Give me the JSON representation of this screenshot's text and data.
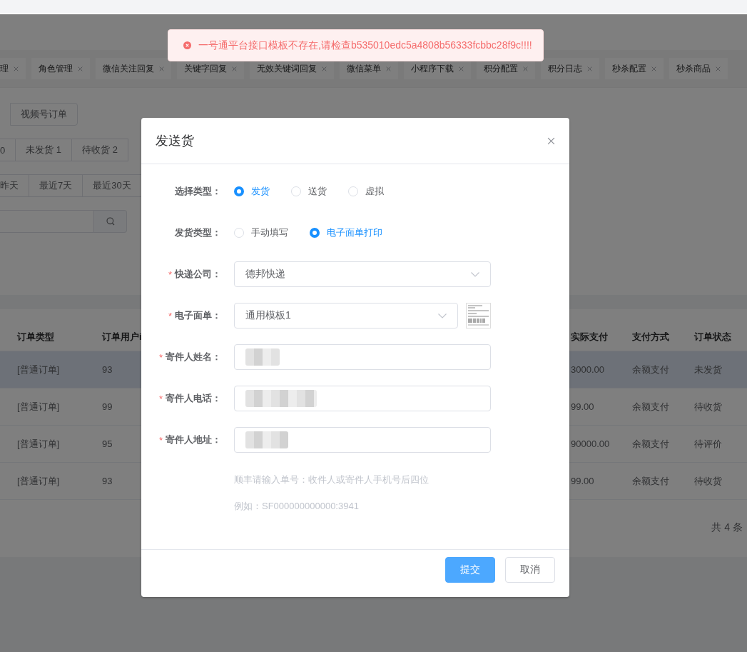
{
  "toast": {
    "kind": "error",
    "text": "一号通平台接口模板不存在,请检查b535010edc5a4808b56333fcbbc28f9c!!!!"
  },
  "tabs": [
    {
      "label": "理"
    },
    {
      "label": "角色管理"
    },
    {
      "label": "微信关注回复"
    },
    {
      "label": "关键字回复"
    },
    {
      "label": "无效关键词回复"
    },
    {
      "label": "微信菜单"
    },
    {
      "label": "小程序下载"
    },
    {
      "label": "积分配置"
    },
    {
      "label": "积分日志"
    },
    {
      "label": "秒杀配置"
    },
    {
      "label": "秒杀商品"
    }
  ],
  "order_sources": [
    "视频号订单"
  ],
  "status_filters": [
    "0",
    "未发货 1",
    "待收货 2"
  ],
  "date_filters": [
    "昨天",
    "最近7天",
    "最近30天"
  ],
  "table": {
    "columns": [
      "订单类型",
      "订单用户i",
      "实际支付",
      "支付方式",
      "订单状态"
    ],
    "rows": [
      {
        "selected": true,
        "cells": [
          "[普通订单]",
          "93",
          "3000.00",
          "余额支付",
          "未发货"
        ]
      },
      {
        "selected": false,
        "cells": [
          "[普通订单]",
          "99",
          "99.00",
          "余额支付",
          "待收货"
        ]
      },
      {
        "selected": false,
        "cells": [
          "[普通订单]",
          "95",
          "90000.00",
          "余额支付",
          "待评价"
        ]
      },
      {
        "selected": false,
        "cells": [
          "[普通订单]",
          "93",
          "99.00",
          "余额支付",
          "待收货"
        ]
      }
    ]
  },
  "total": "共 4 条",
  "dialog": {
    "title": "发送货",
    "fields": [
      {
        "kind": "radio",
        "label": "选择类型：",
        "options": [
          {
            "label": "发货",
            "selected": true
          },
          {
            "label": "送货",
            "selected": false
          },
          {
            "label": "虚拟",
            "selected": false
          }
        ]
      },
      {
        "kind": "radio",
        "label": "发货类型：",
        "options": [
          {
            "label": "手动填写",
            "selected": false
          },
          {
            "label": "电子面单打印",
            "selected": true
          }
        ]
      },
      {
        "kind": "select",
        "label": "快递公司：",
        "required_mark": "*",
        "value": "德邦快递"
      },
      {
        "kind": "select",
        "label": "电子面单：",
        "required_mark": "*",
        "value": "通用模板1",
        "thumbnail": true
      },
      {
        "kind": "text",
        "label": "寄件人姓名：",
        "required_mark": "*",
        "redacted": true
      },
      {
        "kind": "text",
        "label": "寄件人电话：",
        "required_mark": "*",
        "redacted": true
      },
      {
        "kind": "text",
        "label": "寄件人地址：",
        "required_mark": "*",
        "redacted": true
      }
    ],
    "hints": [
      "顺丰请输入单号：收件人或寄件人手机号后四位",
      "例如：SF000000000000:3941"
    ],
    "buttons": [
      {
        "label": "提交",
        "kind": "primary"
      },
      {
        "label": "取消",
        "kind": "default"
      }
    ]
  }
}
